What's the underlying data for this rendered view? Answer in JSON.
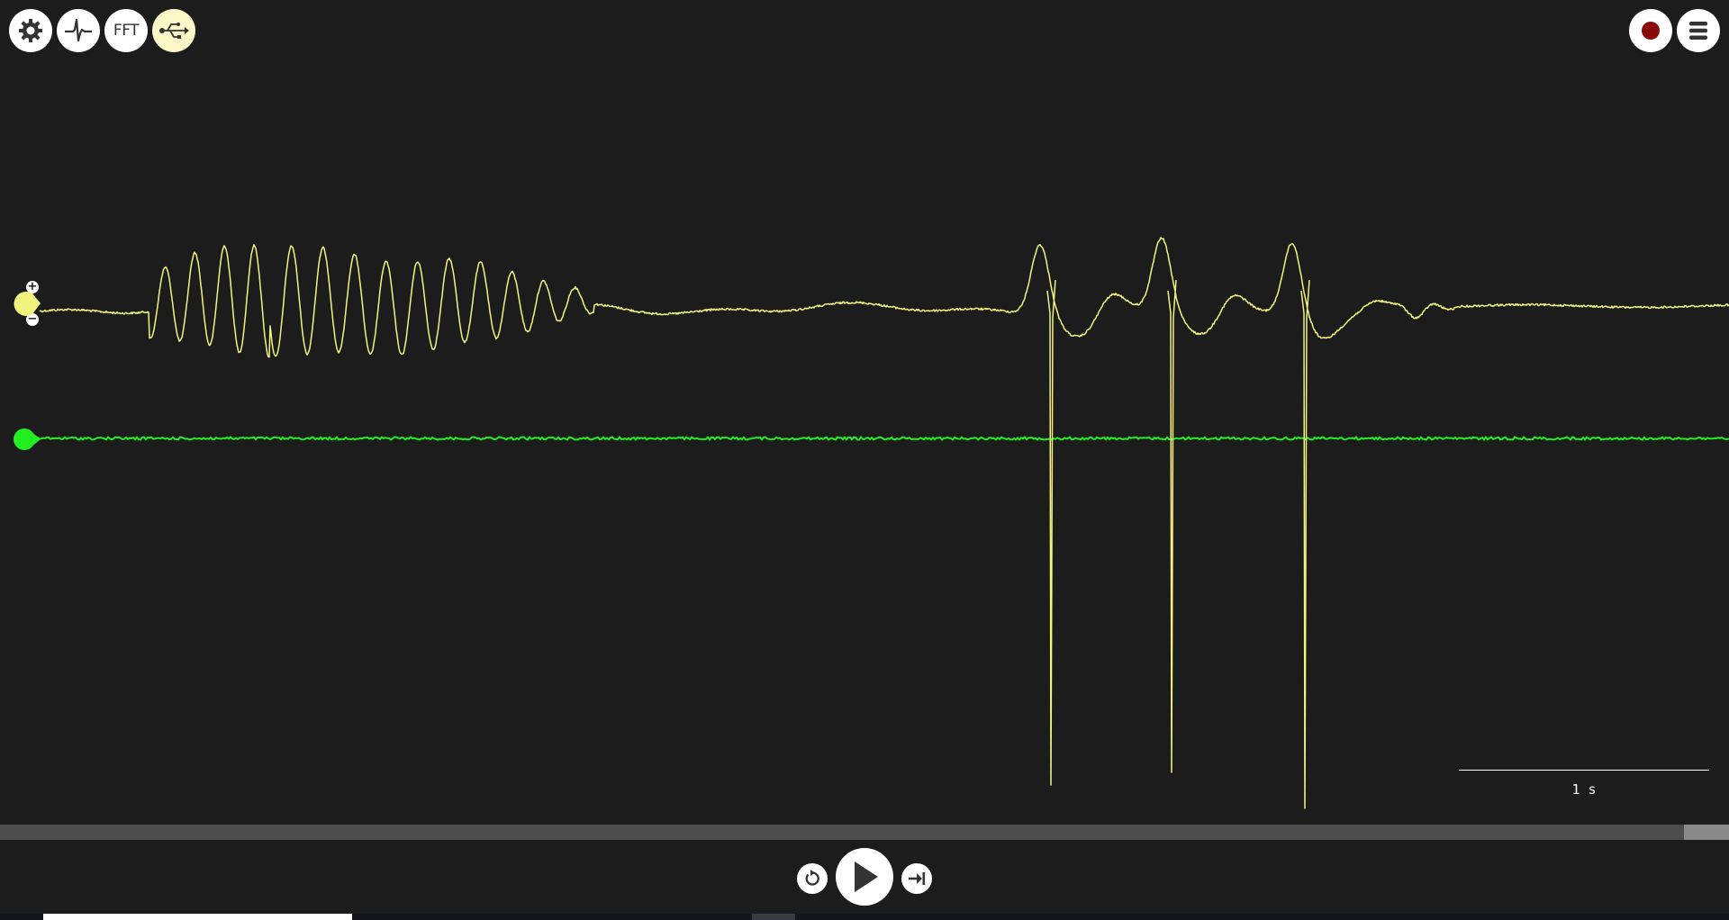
{
  "toolbar": {
    "settings_icon": "gear-icon",
    "threshold_icon": "spike-waveform-icon",
    "fft_label": "FFT",
    "usb_icon": "usb-icon",
    "record_icon": "record-icon",
    "menu_icon": "hamburger-menu-icon"
  },
  "channels": [
    {
      "name": "channel-1",
      "color": "#f2f47e"
    },
    {
      "name": "channel-2",
      "color": "#22ee22"
    }
  ],
  "colors": {
    "background": "#1c1c1c",
    "usb_active": "#fbf7c6",
    "record_dot": "#8a0a0a"
  },
  "timescale": {
    "label": "1 s"
  },
  "playback": {
    "rewind_icon": "rewind-icon",
    "play_icon": "play-icon",
    "skip_to_end_icon": "skip-to-end-icon"
  }
}
